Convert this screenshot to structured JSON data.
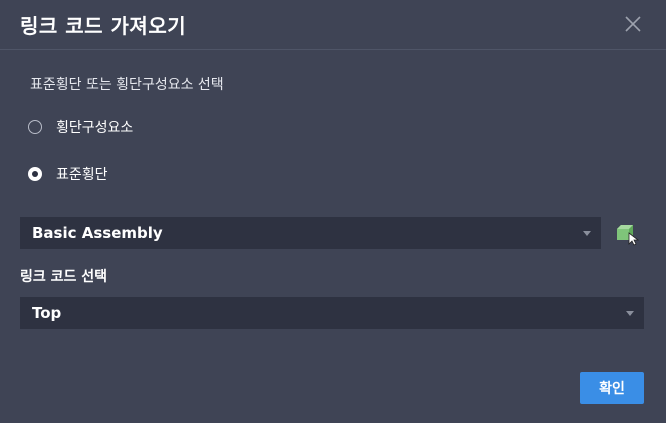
{
  "dialog": {
    "title": "링크 코드 가져오기"
  },
  "assembly_source": {
    "label": "표준횡단 또는 횡단구성요소 선택",
    "options": [
      {
        "label": "횡단구성요소",
        "selected": false
      },
      {
        "label": "표준횡단",
        "selected": true
      }
    ]
  },
  "assembly_select": {
    "value": "Basic Assembly"
  },
  "link_code": {
    "label": "링크 코드 선택",
    "value": "Top"
  },
  "footer": {
    "ok_label": "확인"
  },
  "icons": {
    "close": "close-icon",
    "dropdown": "chevron-down-icon",
    "pick": "pick-from-drawing-icon"
  },
  "colors": {
    "background": "#3f4455",
    "field": "#2e3241",
    "accent": "#3a8ee6",
    "pick_icon": "#7fc47a"
  }
}
